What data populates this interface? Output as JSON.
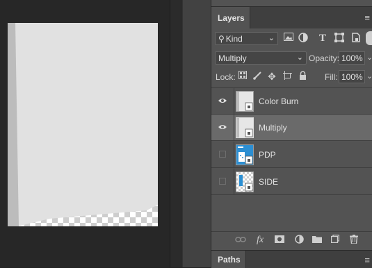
{
  "layers_panel": {
    "tab_label": "Layers",
    "menu_icon": "panel-menu-icon",
    "filter": {
      "kind_label": "Kind",
      "icons": [
        "image-filter-icon",
        "adjustment-filter-icon",
        "type-filter-icon",
        "shape-filter-icon",
        "smart-object-filter-icon"
      ]
    },
    "blend_mode": "Multiply",
    "opacity_label": "Opacity:",
    "opacity_value": "100%",
    "lock_label": "Lock:",
    "lock_icons": [
      "lock-transparent-icon",
      "lock-pixels-icon",
      "lock-position-icon",
      "lock-artboard-icon",
      "lock-all-icon"
    ],
    "fill_label": "Fill:",
    "fill_value": "100%",
    "layers": [
      {
        "name": "Color Burn",
        "visible": true,
        "selected": false
      },
      {
        "name": "Multiply",
        "visible": true,
        "selected": true
      },
      {
        "name": "PDP",
        "visible": false,
        "selected": false
      },
      {
        "name": "SIDE",
        "visible": false,
        "selected": false
      }
    ],
    "bottom_icons": [
      "link-layers-icon",
      "fx-icon",
      "add-mask-icon",
      "adjustment-layer-icon",
      "new-group-icon",
      "new-layer-icon",
      "delete-icon"
    ],
    "fx_label": "fx"
  },
  "paths_panel": {
    "tab_label": "Paths"
  },
  "colors": {
    "panel_bg": "#535353",
    "selected_row": "#6a6a6a",
    "pdp_thumb": "#2c8fd3"
  }
}
